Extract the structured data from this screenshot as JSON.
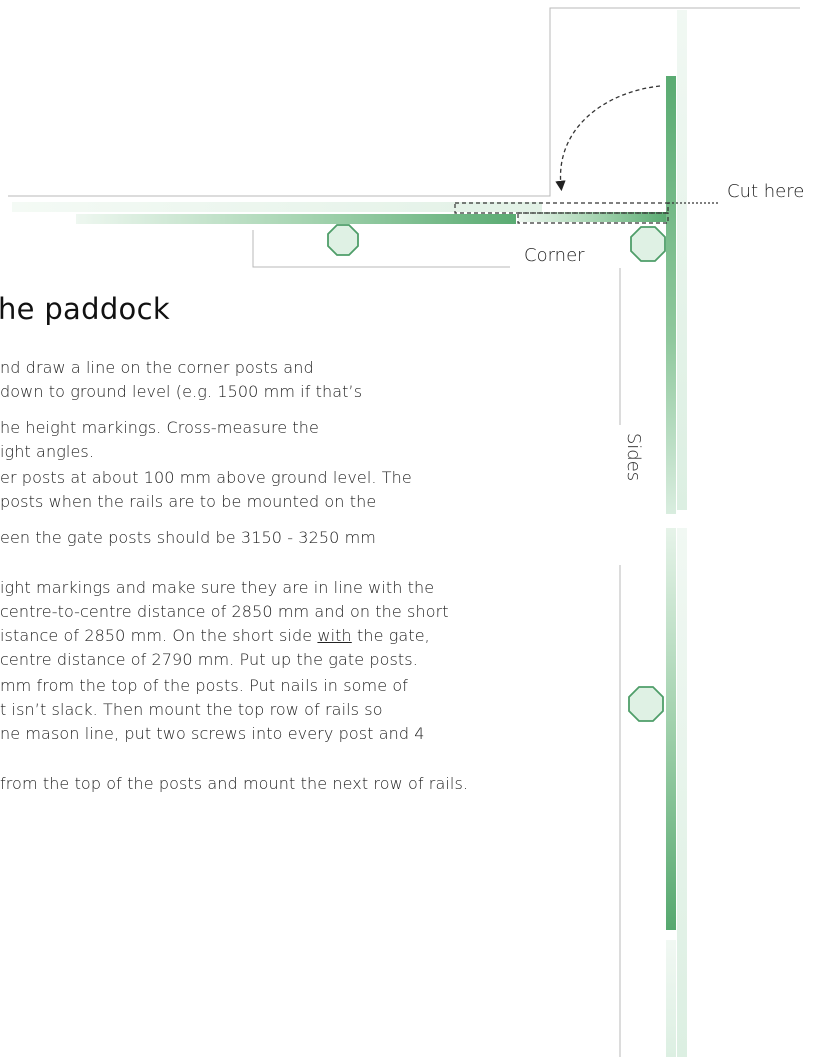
{
  "diagram": {
    "labels": {
      "cut_here": "Cut here",
      "corner": "Corner",
      "sides": "Sides"
    },
    "colors": {
      "rail_dark": "#5aab72",
      "rail_light": "#e6f3e9",
      "post_fill": "#dff1e4",
      "post_stroke": "#4f9e69",
      "outline": "#b5b5b5",
      "dashed": "#333333"
    }
  },
  "section": {
    "heading": "he paddock",
    "lines": [
      {
        "text": "nd draw a line on the corner posts and"
      },
      {
        "text": "down to ground level (e.g. 1500 mm if that’s"
      },
      {
        "text": "he height markings. Cross-measure the"
      },
      {
        "text": "ight angles."
      },
      {
        "text": "er posts at about 100 mm above ground level. The"
      },
      {
        "text": "posts when the rails are to be mounted on the"
      },
      {
        "text": "een the gate posts should be 3150 - 3250 mm"
      },
      {
        "text": "ight markings and make sure they are in line with the"
      },
      {
        "text": "centre-to-centre distance of 2850 mm and on the short"
      },
      {
        "pre": "istance of 2850 mm. On the short side ",
        "underline": "with",
        "post": " the gate,"
      },
      {
        "text": "centre distance of 2790 mm. Put up the gate posts."
      },
      {
        "text": "mm from the top of the posts. Put nails in some of"
      },
      {
        "text": "t isn’t slack. Then mount the top row of rails so"
      },
      {
        "text": "ne mason line, put two screws into every post and 4"
      },
      {
        "text": "from the top of the posts and mount the next row of rails."
      }
    ]
  }
}
